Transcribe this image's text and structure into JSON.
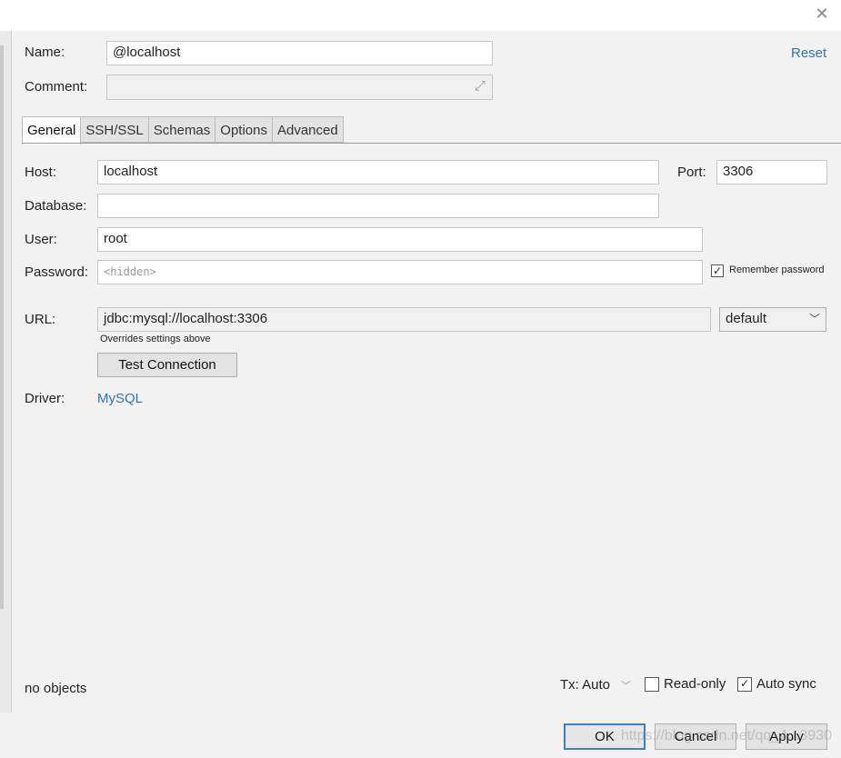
{
  "window": {
    "close_icon": "close-icon"
  },
  "header": {
    "name_label": "Name:",
    "name_value": "@localhost",
    "comment_label": "Comment:",
    "comment_value": "",
    "reset_link": "Reset",
    "expand_icon": "expand-icon"
  },
  "tabs": [
    {
      "label": "General",
      "active": true
    },
    {
      "label": "SSH/SSL",
      "active": false
    },
    {
      "label": "Schemas",
      "active": false
    },
    {
      "label": "Options",
      "active": false
    },
    {
      "label": "Advanced",
      "active": false
    }
  ],
  "general": {
    "host_label": "Host:",
    "host_value": "localhost",
    "port_label": "Port:",
    "port_value": "3306",
    "database_label": "Database:",
    "database_value": "",
    "user_label": "User:",
    "user_value": "root",
    "password_label": "Password:",
    "password_placeholder": "<hidden>",
    "remember_password_label": "Remember password",
    "remember_password_checked": true,
    "url_label": "URL:",
    "url_value": "jdbc:mysql://localhost:3306",
    "url_mode": "default",
    "url_note": "Overrides settings above",
    "test_connection_label": "Test Connection",
    "driver_label": "Driver:",
    "driver_value": "MySQL"
  },
  "status": {
    "objects_text": "no objects",
    "tx_label": "Tx: Auto",
    "read_only_label": "Read-only",
    "read_only_checked": false,
    "auto_sync_label": "Auto sync",
    "auto_sync_checked": true
  },
  "buttons": {
    "ok": "OK",
    "cancel": "Cancel",
    "apply": "Apply"
  },
  "watermark": "https://blog.csdn.net/qq_4...3930",
  "colors": {
    "link": "#2e72b8",
    "primary_border": "#3c7fd1"
  }
}
